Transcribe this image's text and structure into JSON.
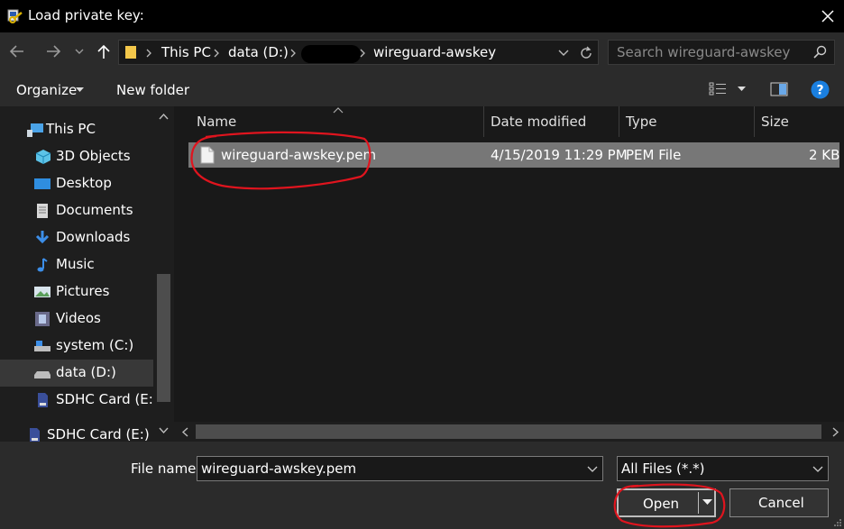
{
  "window": {
    "title": "Load private key:",
    "app_icon": "puttygen-key-icon",
    "close_icon": "close-icon"
  },
  "address": {
    "crumbs": [
      "This PC",
      "data (D:)",
      "wireguard-awskey"
    ],
    "redacted_crumb_visible": true
  },
  "search": {
    "placeholder": "Search wireguard-awskey"
  },
  "toolbar": {
    "organize_label": "Organize",
    "new_folder_label": "New folder"
  },
  "sidebar": {
    "items": [
      {
        "label": "This PC",
        "icon": "this-pc-icon"
      },
      {
        "label": "3D Objects",
        "icon": "3d-objects-icon"
      },
      {
        "label": "Desktop",
        "icon": "desktop-icon"
      },
      {
        "label": "Documents",
        "icon": "documents-icon"
      },
      {
        "label": "Downloads",
        "icon": "downloads-icon"
      },
      {
        "label": "Music",
        "icon": "music-icon"
      },
      {
        "label": "Pictures",
        "icon": "pictures-icon"
      },
      {
        "label": "Videos",
        "icon": "videos-icon"
      },
      {
        "label": "system (C:)",
        "icon": "drive-icon"
      },
      {
        "label": "data (D:)",
        "icon": "drive-icon"
      },
      {
        "label": "SDHC Card (E:)",
        "icon": "sd-card-icon"
      },
      {
        "label": "SDHC Card (E:)",
        "icon": "sd-card-icon"
      }
    ],
    "selected_index": 9
  },
  "filelist": {
    "columns": [
      "Name",
      "Date modified",
      "Type",
      "Size"
    ],
    "rows": [
      {
        "name": "wireguard-awskey.pem",
        "date": "4/15/2019 11:29 PM",
        "type": "PEM File",
        "size": "2 KB"
      }
    ]
  },
  "bottom": {
    "file_name_label": "File name:",
    "file_name_value": "wireguard-awskey.pem",
    "filter_value": "All Files (*.*)",
    "open_label": "Open",
    "cancel_label": "Cancel"
  },
  "colors": {
    "dark_bg": "#191919",
    "panel_bg": "#2b2b2b",
    "selected_row": "#777777",
    "annotation_red": "#e0141e",
    "help_blue": "#1a7fe0"
  }
}
